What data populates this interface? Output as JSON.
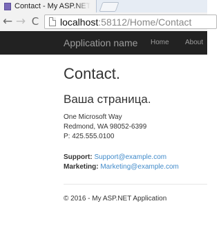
{
  "browser": {
    "tab_title": "Contact - My ASP.NET Application",
    "url_host": "localhost",
    "url_path": ":58112/Home/Contact",
    "back_glyph": "←",
    "forward_glyph": "→",
    "reload_glyph": "C"
  },
  "navbar": {
    "brand": "Application name",
    "links": [
      "Home",
      "About"
    ]
  },
  "main": {
    "title": "Contact.",
    "subtitle": "Ваша страница.",
    "address": [
      "One Microsoft Way",
      "Redmond, WA 98052-6399",
      "P: 425.555.0100"
    ],
    "contacts": [
      {
        "label": "Support:",
        "email": "Support@example.com"
      },
      {
        "label": "Marketing:",
        "email": "Marketing@example.com"
      }
    ]
  },
  "footer": {
    "text": "© 2016 - My ASP.NET Application"
  },
  "colors": {
    "navbar_bg": "#222222",
    "nav_text": "#9d9d9d",
    "link": "#428bca",
    "text": "#333333"
  },
  "icons": [
    "favicon-icon",
    "back-arrow-icon",
    "forward-arrow-icon",
    "reload-icon",
    "page-icon"
  ]
}
